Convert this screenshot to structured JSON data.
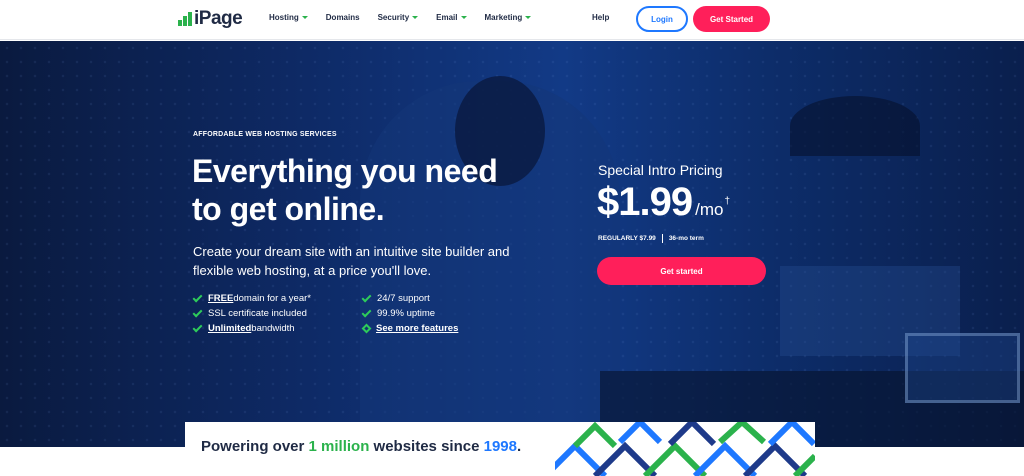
{
  "nav": {
    "logo": "iPage",
    "menu": [
      {
        "label": "Hosting",
        "dropdown": true
      },
      {
        "label": "Domains",
        "dropdown": false
      },
      {
        "label": "Security",
        "dropdown": true
      },
      {
        "label": "Email",
        "dropdown": true
      },
      {
        "label": "Marketing",
        "dropdown": true
      }
    ],
    "help": "Help",
    "login": "Login",
    "get_started": "Get Started"
  },
  "hero": {
    "eyebrow": "AFFORDABLE WEB HOSTING SERVICES",
    "headline": "Everything you need to get online.",
    "subheadline": "Create your dream site with an intuitive site builder and flexible web hosting, at a price you'll love.",
    "features_left": [
      {
        "strong": "FREE",
        "text": " domain for a year*"
      },
      {
        "strong": "",
        "text": "SSL certificate included"
      },
      {
        "strong": "Unlimited",
        "text": " bandwidth"
      }
    ],
    "features_right": [
      {
        "text": "24/7 support"
      },
      {
        "text": "99.9% uptime"
      },
      {
        "text": "See more features"
      }
    ]
  },
  "pricing": {
    "label": "Special Intro Pricing",
    "price": "$1.99",
    "unit": "/mo",
    "dagger": "†",
    "regular": "REGULARLY $7.99",
    "term": "36-mo term",
    "cta": "Get started"
  },
  "banner": {
    "prefix": "Powering over ",
    "highlight1": "1 million",
    "middle": " websites since ",
    "highlight2": "1998",
    "suffix": "."
  },
  "colors": {
    "brand_green": "#2bb24c",
    "brand_pink": "#ff1f5a",
    "brand_blue": "#1e78ff",
    "navy": "#1f2a44"
  }
}
